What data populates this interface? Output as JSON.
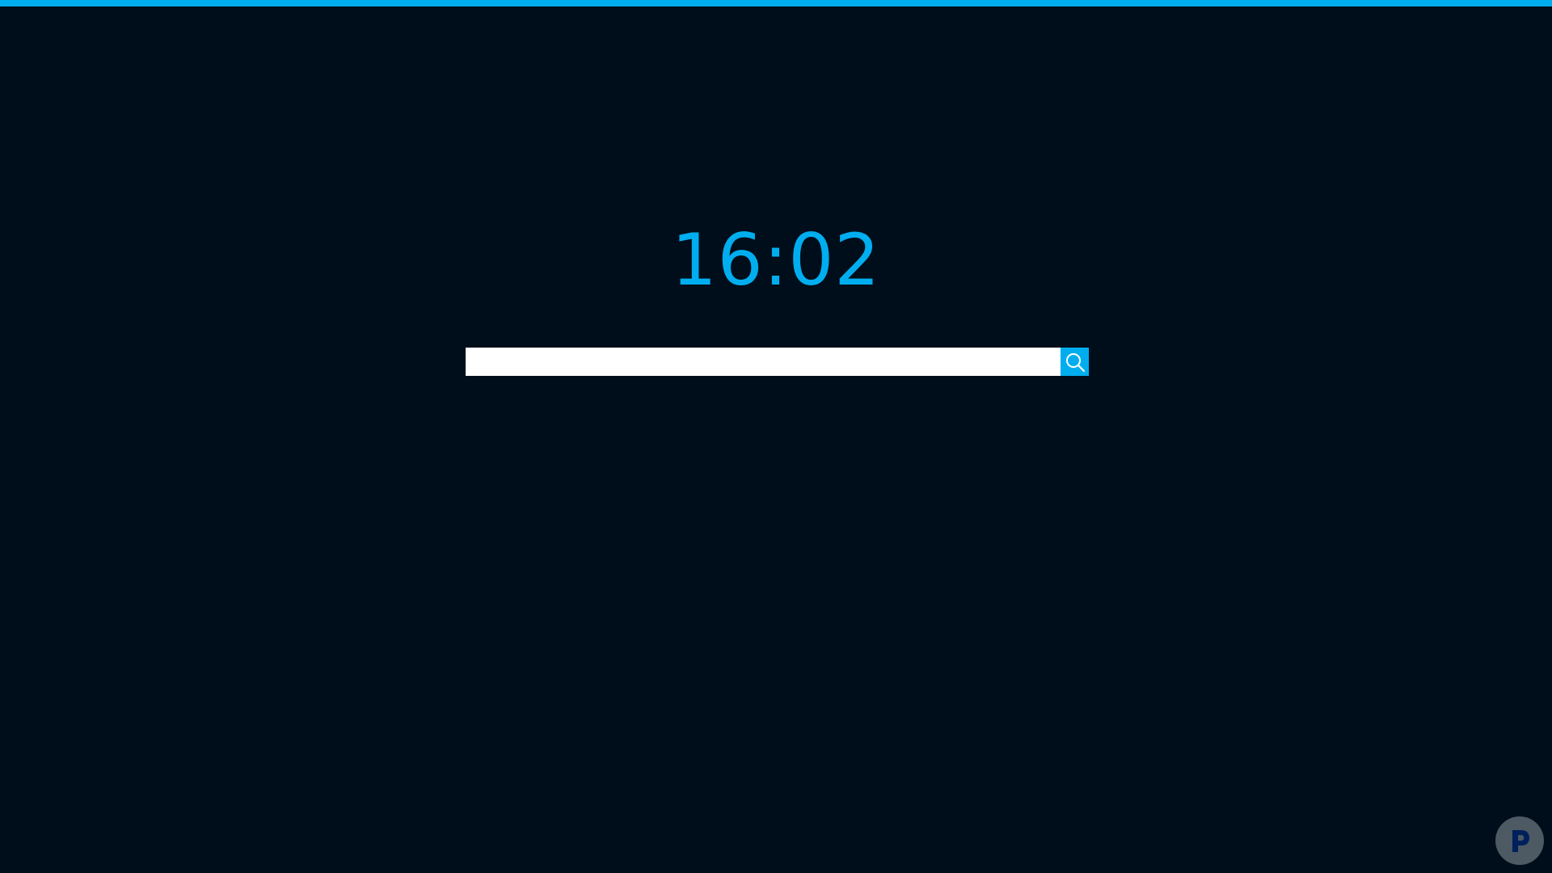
{
  "colors": {
    "background": "#000e1b",
    "accent": "#00aeef",
    "input_background": "#ffffff",
    "badge_background": "#4d5963",
    "badge_glyph": "#00205b"
  },
  "clock": {
    "time": "16:02"
  },
  "search": {
    "value": "",
    "placeholder": "",
    "button_icon": "search-icon"
  },
  "corner_badge": {
    "icon": "p-logo-icon"
  }
}
